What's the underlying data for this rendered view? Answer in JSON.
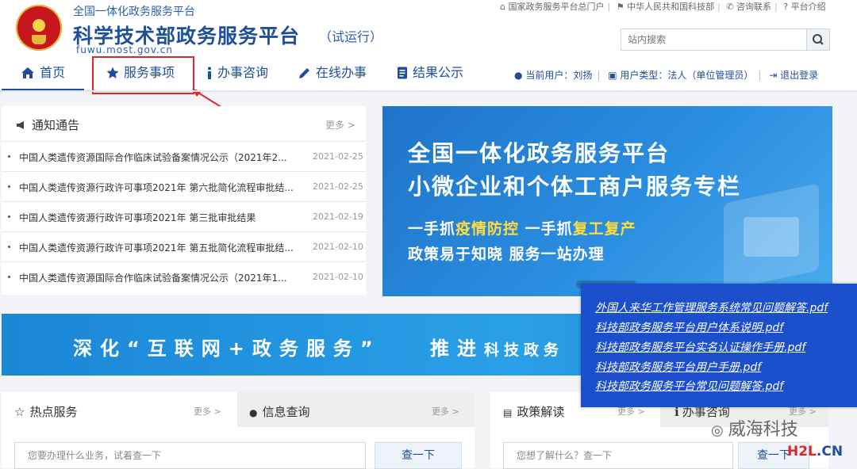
{
  "header": {
    "subtitle": "全国一体化政务服务平台",
    "title": "科学技术部政务服务平台",
    "trial": "（试运行）",
    "domain": "fuwu.most.gov.cn",
    "top_links": [
      "国家政务服务平台总门户",
      "中华人民共和国科技部",
      "咨询联系",
      "平台介绍"
    ],
    "search_placeholder": "站内搜索"
  },
  "nav": {
    "items": [
      {
        "label": "首页",
        "icon": "home-icon"
      },
      {
        "label": "服务事项",
        "icon": "star-icon"
      },
      {
        "label": "办事咨询",
        "icon": "info-icon"
      },
      {
        "label": "在线办事",
        "icon": "pencil-icon"
      },
      {
        "label": "结果公示",
        "icon": "document-icon"
      }
    ],
    "active": "首页",
    "user": {
      "current_user": "当前用户：刘扬",
      "user_type": "用户类型：法人（单位管理员）",
      "logout": "退出登录"
    }
  },
  "notice": {
    "title": "通知通告",
    "more": "更多 >",
    "items": [
      {
        "text": "中国人类遗传资源国际合作临床试验备案情况公示（2021年2...",
        "date": "2021-02-25"
      },
      {
        "text": "中国人类遗传资源行政许可事项2021年 第六批简化流程审批结...",
        "date": "2021-02-25"
      },
      {
        "text": "中国人类遗传资源行政许可事项2021年 第三批审批结果",
        "date": "2021-02-19"
      },
      {
        "text": "中国人类遗传资源行政许可事项2021年 第五批简化流程审批结...",
        "date": "2021-02-10"
      },
      {
        "text": "中国人类遗传资源国际合作临床试验备案情况公示（2021年1...",
        "date": "2021-02-10"
      }
    ]
  },
  "banner": {
    "line1": "全国一体化政务服务平台",
    "line2": "小微企业和个体工商户服务专栏",
    "line3_a": "一手抓",
    "line3_b": "疫情防控",
    "line3_c": " 一手抓",
    "line3_d": "复工复产",
    "line4": "政策易于知晓 服务一站办理"
  },
  "strip": {
    "text1": "深化“互联网+政务服务”",
    "text2a": "推进",
    "text2b": "科技政务"
  },
  "overlay": {
    "links": [
      "外国人来华工作管理服务系统常见问题解答.pdf",
      "科技部政务服务平台用户体系说明.pdf",
      "科技部政务服务平台实名认证操作手册.pdf",
      "科技部政务服务平台用户手册.pdf",
      "科技部政务服务平台常见问题解答.pdf"
    ]
  },
  "bottom": {
    "hot_title": "热点服务",
    "hot_more": "更多 >",
    "info_title": "信息查询",
    "info_more": "更多 >",
    "search_placeholder": "您要办理什么业务，试着查一下",
    "search_button": "查一下",
    "policy_title": "政策解读",
    "policy_more": "更多 >",
    "consult_title": "办事咨询",
    "consult_more": "更多 >",
    "policy_placeholder": "您想了解什么？查一下",
    "policy_button": "查一下"
  },
  "watermark": {
    "text": "威海科技",
    "brand_a": "H2L",
    "brand_b": ".CN"
  }
}
